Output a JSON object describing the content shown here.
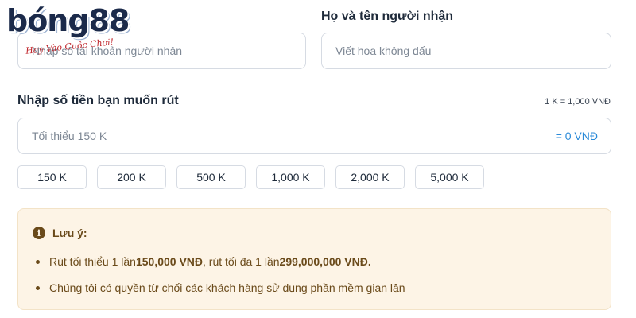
{
  "brand": {
    "logo_text": "bóng88",
    "slogan": "Hay Vào Cuộc Chơi!"
  },
  "form": {
    "account": {
      "placeholder": "Nhập số tài khoản người nhận"
    },
    "recipient": {
      "label": "Họ và tên người nhận",
      "placeholder": "Viết hoa không dấu"
    },
    "amount": {
      "label": "Nhập số tiền bạn muốn rút",
      "rate_text": "1 K = 1,000 VNĐ",
      "placeholder": "Tối thiểu 150 K",
      "converted_text": "= 0 VNĐ"
    },
    "quick_amounts": [
      "150 K",
      "200 K",
      "500 K",
      "1,000 K",
      "2,000 K",
      "5,000 K"
    ]
  },
  "notice": {
    "title": "Lưu ý:",
    "line1": {
      "p1": "Rút tối thiểu 1 lần ",
      "b1": "150,000 VNĐ",
      "p2": ", rút tối đa 1 lần ",
      "b2": "299,000,000 VNĐ."
    },
    "line2": "Chúng tôi có quyền từ chối các khách hàng sử dụng phần mềm gian lận"
  },
  "colors": {
    "accent": "#2a8ad8",
    "notice_bg": "#fdf4e6",
    "notice_text": "#6a4a1a"
  }
}
